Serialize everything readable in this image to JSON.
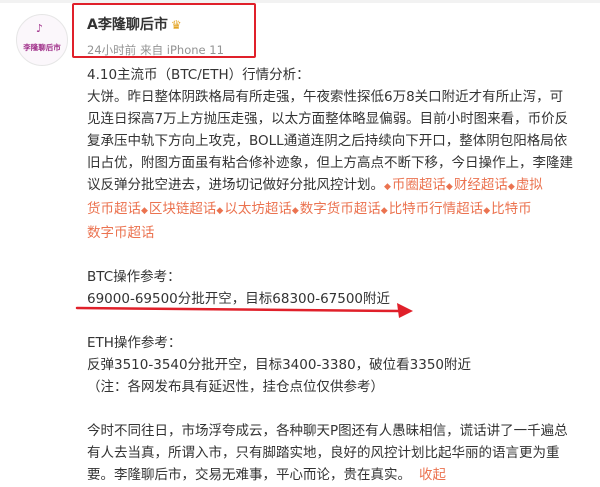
{
  "author": {
    "avatar_text": "李隆聊后市",
    "name": "A李隆聊后市",
    "badge_icon": "crown-icon",
    "time": "24小时前",
    "source": "来自 iPhone 11"
  },
  "post": {
    "title": "4.10主流币（BTC/ETH）行情分析：",
    "body_lines": [
      "大饼。昨日整体阴跌格局有所走强，午夜索性探低6万8关口附近才有所止泻，可",
      "见连日探高7万上方抛压走强，以太方面整体略显偏弱。目前小时图来看，币价反",
      "复承压中轨下方向上攻克，BOLL通道连阴之后持续向下开口，整体阴包阳格局依",
      "旧占优，附图方面虽有粘合修补迹象，但上方高点不断下移，今日操作上，李隆建"
    ],
    "body_last": "议反弹分批空进去，进场切记做好分批风控计划。",
    "topics": [
      "币圈超话",
      "财经超话",
      "虚拟货币超话",
      "区块链超话",
      "以太坊超话",
      "数字货币超话",
      "比特币行情超话",
      "比特币数字币超话"
    ],
    "btc_header": "BTC操作参考：",
    "btc_plan": "69000-69500分批开空，目标68300-67500附近",
    "eth_header": "ETH操作参考：",
    "eth_plan": "反弹3510-3540分批开空，目标3400-3380，破位看3350附近",
    "note": "（注：各网发布具有延迟性，挂仓点位仅供参考）",
    "closing_lines": [
      "今时不同往日，市场浮夸成云，各种聊天P图还有人愚昧相信，谎话讲了一千遍总",
      "有人去当真，所谓入市，只有脚踏实地，良好的风控计划比起华丽的语言更为重"
    ],
    "closing_last": "要。李隆聊后市，交易无难事，平心而论，贵在真实。",
    "fold_label": "收起"
  },
  "colors": {
    "topic": "#eb7350",
    "highlight_box": "#e0202a",
    "arrow": "#e0202a"
  }
}
